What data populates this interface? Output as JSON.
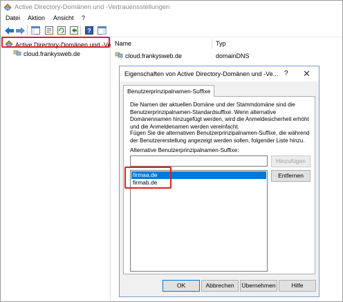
{
  "window": {
    "title": "Active Directory-Domänen und -Vertrauensstellungen"
  },
  "menu": [
    "Datei",
    "Aktion",
    "Ansicht",
    "?"
  ],
  "toolbar": {
    "icons": [
      "back-arrow-icon",
      "forward-arrow-icon",
      "console-tree-icon",
      "properties-icon",
      "refresh-icon",
      "export-list-icon",
      "help-icon",
      "show-hide-pane-icon"
    ]
  },
  "tree": {
    "root_label": "Active Directory-Domänen und -Ve",
    "child_label": "cloud.frankysweb.de"
  },
  "list": {
    "columns": [
      "Name",
      "Typ"
    ],
    "rows": [
      {
        "name": "cloud.frankysweb.de",
        "type": "domainDNS"
      }
    ]
  },
  "dialog": {
    "title": "Eigenschaften von Active Directory-Domänen und -Ve...",
    "help_glyph": "?",
    "close_glyph": "✕",
    "tab_label": "Benutzerprinzipalnamen-Suffixe",
    "description": "Die Namen der aktuellen Domäne und der Stammdomäne sind die Benutzerprinzipalnamen-Standardsuffixe. Wenn alternative Domänennamen hinzugefügt werden, wird die Anmeldesicherheit erhöht und die Anmeldenamen werden vereinfacht.",
    "instruction": "Fügen Sie die alternativen Benutzerprinzipalnamen-Suffixe, die während der Benutzererstellung angezeigt werden sollen, folgender Liste hinzu.",
    "field_label": "Alternative Benutzerprinzipalnamen-Suffixe:",
    "input_value": "",
    "add_button": "Hinzufügen",
    "remove_button": "Entfernen",
    "suffixes": [
      {
        "label": "firmaa.de",
        "selected": true
      },
      {
        "label": "firmab.de",
        "selected": false
      }
    ],
    "buttons": {
      "ok": "OK",
      "cancel": "Abbrechen",
      "apply": "Übernehmen",
      "help": "Hilfe"
    }
  },
  "colors": {
    "highlight_box": "#e0201e",
    "selection": "#0078d7",
    "dialog_bg": "#f0f0f0"
  }
}
